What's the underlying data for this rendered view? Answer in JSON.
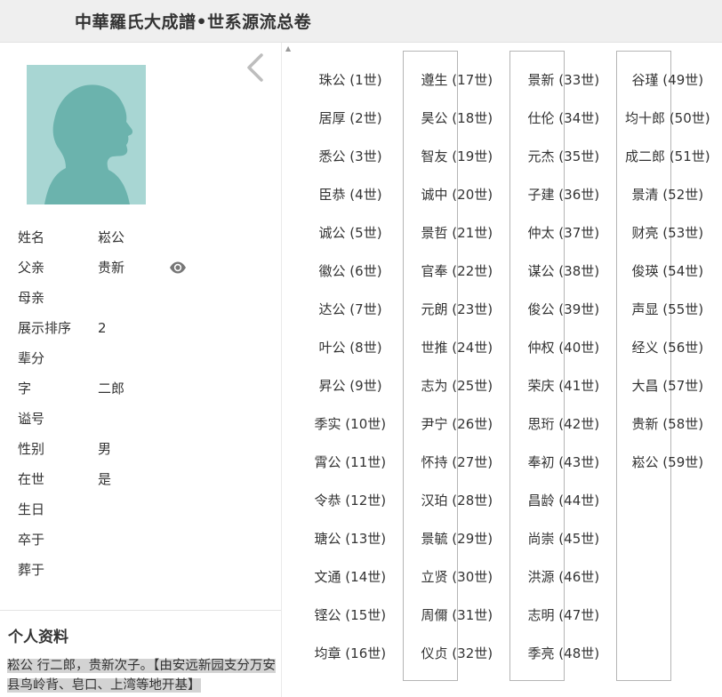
{
  "header": {
    "title": "中華羅氏大成譜•世系源流总卷"
  },
  "person": {
    "fields": [
      {
        "label": "姓名",
        "value": "崧公"
      },
      {
        "label": "父亲",
        "value": "贵新"
      },
      {
        "label": "母亲",
        "value": ""
      },
      {
        "label": "展示排序",
        "value": "2"
      },
      {
        "label": "辈分",
        "value": ""
      },
      {
        "label": "字",
        "value": "二郎"
      },
      {
        "label": "谥号",
        "value": ""
      },
      {
        "label": "性别",
        "value": "男"
      },
      {
        "label": "在世",
        "value": "是"
      },
      {
        "label": "生日",
        "value": ""
      },
      {
        "label": "卒于",
        "value": ""
      },
      {
        "label": "葬于",
        "value": ""
      }
    ]
  },
  "profile": {
    "title": "个人资料",
    "text": "崧公 行二郎，贵新次子。【由安远新园支分万安县鸟岭背、皂口、上湾等地开基】"
  },
  "icons": {
    "avatar": "person-silhouette",
    "collapse": "chevron-left-icon",
    "father_view": "eye-icon"
  },
  "generations": [
    {
      "name": "珠公",
      "gen": "(1世)"
    },
    {
      "name": "居厚",
      "gen": "(2世)"
    },
    {
      "name": "悉公",
      "gen": "(3世)"
    },
    {
      "name": "臣恭",
      "gen": "(4世)"
    },
    {
      "name": "诚公",
      "gen": "(5世)"
    },
    {
      "name": "徽公",
      "gen": "(6世)"
    },
    {
      "name": "达公",
      "gen": "(7世)"
    },
    {
      "name": "叶公",
      "gen": "(8世)"
    },
    {
      "name": "昇公",
      "gen": "(9世)"
    },
    {
      "name": "季实",
      "gen": "(10世)"
    },
    {
      "name": "霄公",
      "gen": "(11世)"
    },
    {
      "name": "令恭",
      "gen": "(12世)"
    },
    {
      "name": "瑭公",
      "gen": "(13世)"
    },
    {
      "name": "文通",
      "gen": "(14世)"
    },
    {
      "name": "铿公",
      "gen": "(15世)"
    },
    {
      "name": "均章",
      "gen": "(16世)"
    },
    {
      "name": "遵生",
      "gen": "(17世)"
    },
    {
      "name": "昊公",
      "gen": "(18世)"
    },
    {
      "name": "智友",
      "gen": "(19世)"
    },
    {
      "name": "诚中",
      "gen": "(20世)"
    },
    {
      "name": "景哲",
      "gen": "(21世)"
    },
    {
      "name": "官奉",
      "gen": "(22世)"
    },
    {
      "name": "元朗",
      "gen": "(23世)"
    },
    {
      "name": "世推",
      "gen": "(24世)"
    },
    {
      "name": "志为",
      "gen": "(25世)"
    },
    {
      "name": "尹宁",
      "gen": "(26世)"
    },
    {
      "name": "怀持",
      "gen": "(27世)"
    },
    {
      "name": "汉珀",
      "gen": "(28世)"
    },
    {
      "name": "景毓",
      "gen": "(29世)"
    },
    {
      "name": "立贤",
      "gen": "(30世)"
    },
    {
      "name": "周儞",
      "gen": "(31世)"
    },
    {
      "name": "仪贞",
      "gen": "(32世)"
    },
    {
      "name": "景新",
      "gen": "(33世)"
    },
    {
      "name": "仕伦",
      "gen": "(34世)"
    },
    {
      "name": "元杰",
      "gen": "(35世)"
    },
    {
      "name": "子建",
      "gen": "(36世)"
    },
    {
      "name": "仲太",
      "gen": "(37世)"
    },
    {
      "name": "谋公",
      "gen": "(38世)"
    },
    {
      "name": "俊公",
      "gen": "(39世)"
    },
    {
      "name": "仲权",
      "gen": "(40世)"
    },
    {
      "name": "荣庆",
      "gen": "(41世)"
    },
    {
      "name": "思珩",
      "gen": "(42世)"
    },
    {
      "name": "奉初",
      "gen": "(43世)"
    },
    {
      "name": "昌龄",
      "gen": "(44世)"
    },
    {
      "name": "尚崇",
      "gen": "(45世)"
    },
    {
      "name": "洪源",
      "gen": "(46世)"
    },
    {
      "name": "志明",
      "gen": "(47世)"
    },
    {
      "name": "季亮",
      "gen": "(48世)"
    },
    {
      "name": "谷瑾",
      "gen": "(49世)"
    },
    {
      "name": "均十郎",
      "gen": "(50世)"
    },
    {
      "name": "成二郎",
      "gen": "(51世)"
    },
    {
      "name": "景清",
      "gen": "(52世)"
    },
    {
      "name": "财亮",
      "gen": "(53世)"
    },
    {
      "name": "俊瑛",
      "gen": "(54世)"
    },
    {
      "name": "声显",
      "gen": "(55世)"
    },
    {
      "name": "经义",
      "gen": "(56世)"
    },
    {
      "name": "大昌",
      "gen": "(57世)"
    },
    {
      "name": "贵新",
      "gen": "(58世)"
    },
    {
      "name": "崧公",
      "gen": "(59世)"
    }
  ]
}
